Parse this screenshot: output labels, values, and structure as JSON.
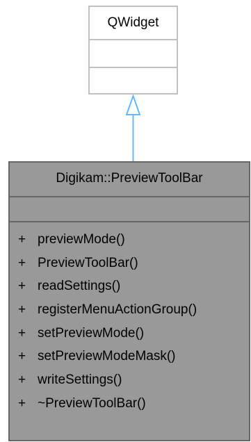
{
  "base_class": {
    "name": "QWidget"
  },
  "main_class": {
    "name": "Digikam::PreviewToolBar",
    "methods": [
      {
        "visibility": "+",
        "name": "previewMode()"
      },
      {
        "visibility": "+",
        "name": "PreviewToolBar()"
      },
      {
        "visibility": "+",
        "name": "readSettings()"
      },
      {
        "visibility": "+",
        "name": "registerMenuActionGroup()"
      },
      {
        "visibility": "+",
        "name": "setPreviewMode()"
      },
      {
        "visibility": "+",
        "name": "setPreviewModeMask()"
      },
      {
        "visibility": "+",
        "name": "writeSettings()"
      },
      {
        "visibility": "+",
        "name": "~PreviewToolBar()"
      }
    ]
  },
  "colors": {
    "arrow": "#63b8ff",
    "base_border": "#c1c1c1",
    "main_fill": "#999999",
    "main_border": "#666666"
  }
}
